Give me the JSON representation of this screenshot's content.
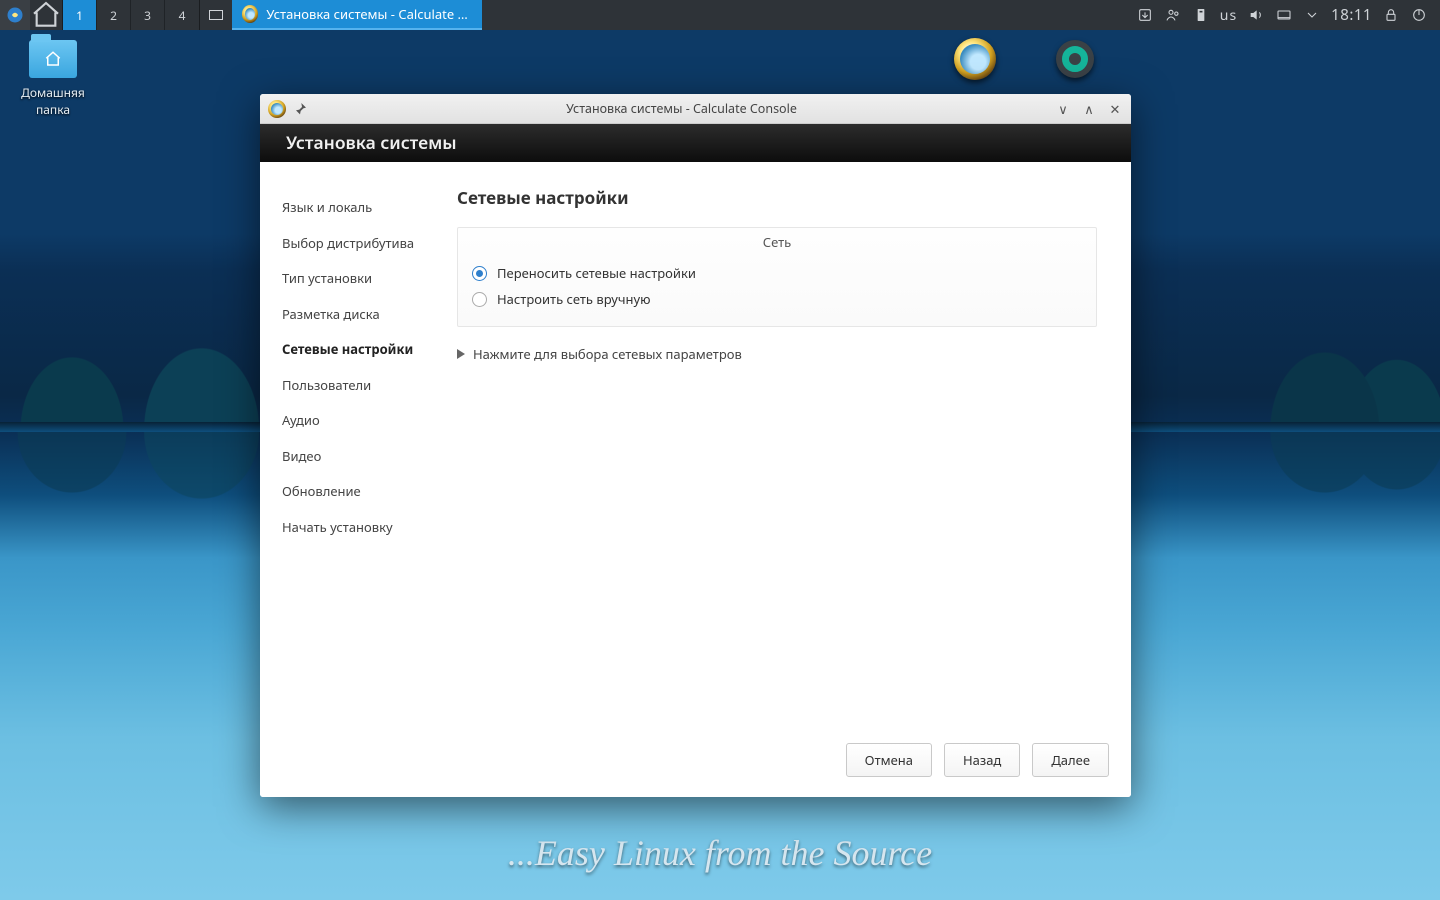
{
  "taskbar": {
    "pager": [
      "1",
      "2",
      "3",
      "4"
    ],
    "active_pager": 0,
    "task_label": "Установка системы - Calculate Con...",
    "keyboard": "us",
    "time": "18:11"
  },
  "desktop": {
    "home_label": "Домашняя\nпапка",
    "slogan": "...Easy Linux from the Source"
  },
  "dialog": {
    "title": "Установка системы - Calculate Console",
    "banner": "Установка системы",
    "steps": [
      "Язык и локаль",
      "Выбор дистрибутива",
      "Тип установки",
      "Разметка диска",
      "Сетевые настройки",
      "Пользователи",
      "Аудио",
      "Видео",
      "Обновление",
      "Начать установку"
    ],
    "active_step": 4,
    "page_heading": "Сетевые настройки",
    "fieldset_legend": "Сеть",
    "radios": {
      "transfer": "Переносить сетевые настройки",
      "manual": "Настроить сеть вручную"
    },
    "selected_radio": "transfer",
    "expander": "Нажмите для выбора сетевых параметров",
    "buttons": {
      "cancel": "Отмена",
      "back": "Назад",
      "next": "Далее"
    }
  }
}
